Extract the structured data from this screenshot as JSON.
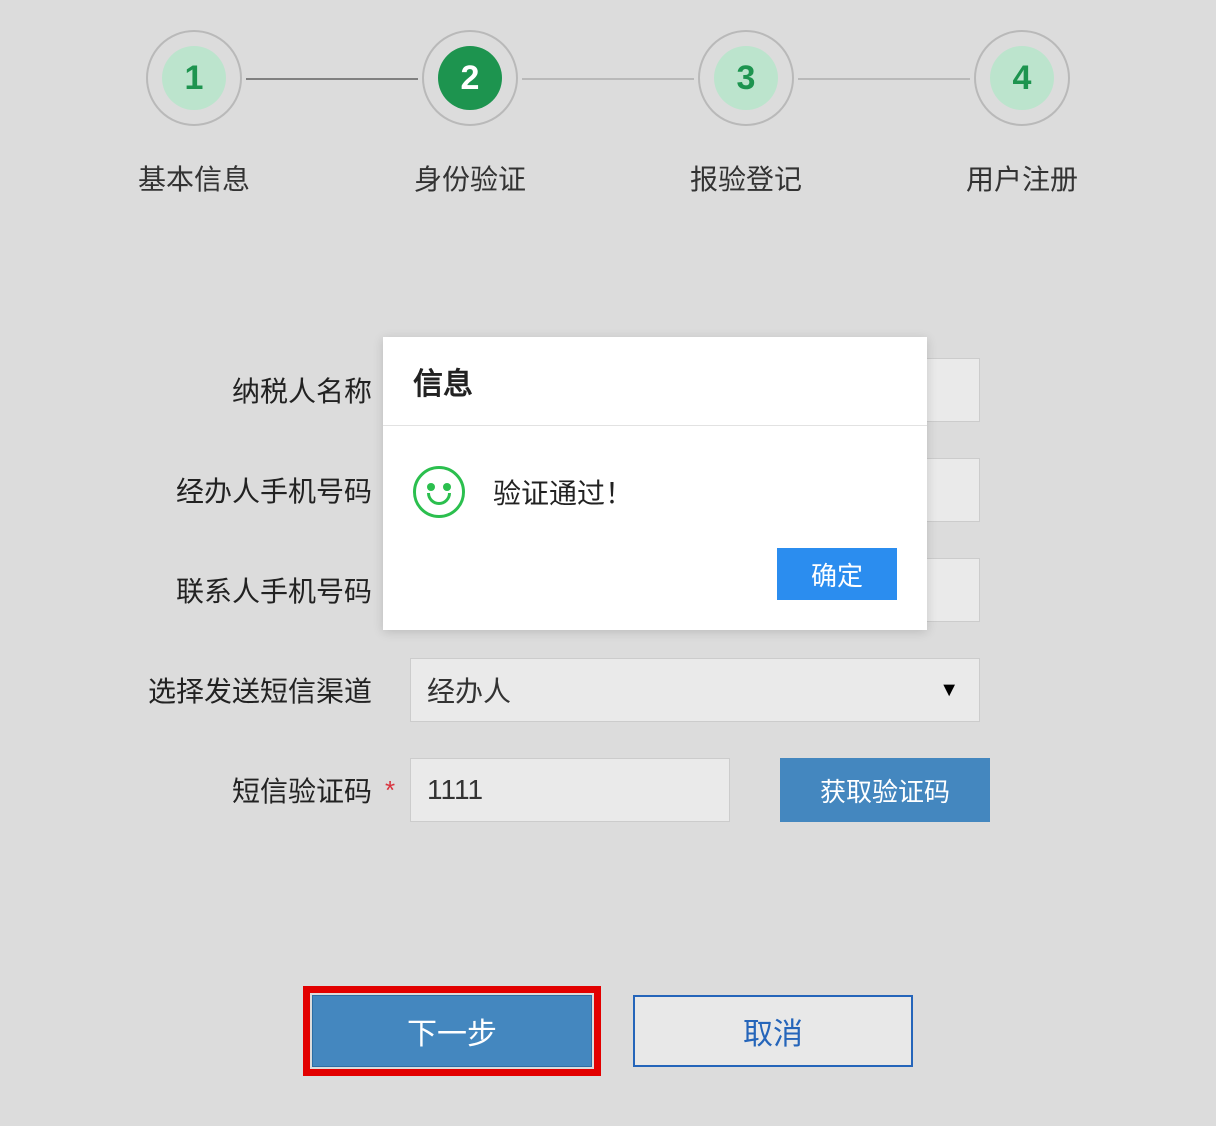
{
  "stepper": {
    "steps": [
      {
        "number": "1",
        "label": "基本信息"
      },
      {
        "number": "2",
        "label": "身份验证"
      },
      {
        "number": "3",
        "label": "报验登记"
      },
      {
        "number": "4",
        "label": "用户注册"
      }
    ]
  },
  "form": {
    "taxpayer_name_label": "纳税人名称",
    "agent_phone_label": "经办人手机号码",
    "contact_phone_label": "联系人手机号码",
    "sms_channel_label": "选择发送短信渠道",
    "sms_channel_value": "经办人",
    "sms_code_label": "短信验证码",
    "sms_code_value": "1111",
    "get_code_button": "获取验证码",
    "required_mark": "*"
  },
  "buttons": {
    "next": "下一步",
    "cancel": "取消"
  },
  "modal": {
    "title": "信息",
    "message": "验证通过！",
    "ok": "确定"
  }
}
